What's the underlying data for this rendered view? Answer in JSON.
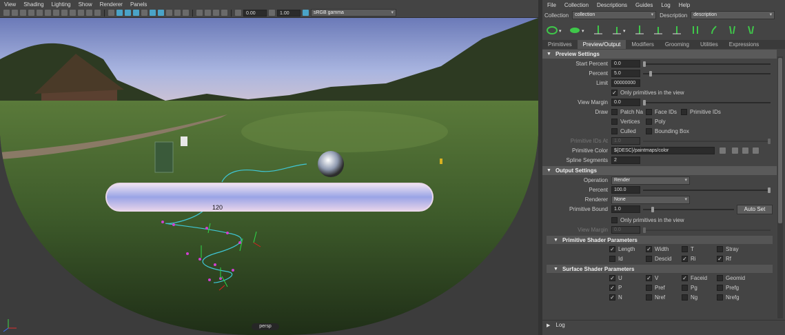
{
  "viewport": {
    "menu": [
      "View",
      "Shading",
      "Lighting",
      "Show",
      "Renderer",
      "Panels"
    ],
    "exposure": "0.00",
    "gamma_value": "1.00",
    "color_space": "sRGB gamma",
    "camera_label": "persp",
    "hud_number": "120"
  },
  "editor": {
    "menu": [
      "File",
      "Collection",
      "Descriptions",
      "Guides",
      "Log",
      "Help"
    ],
    "collection_label": "Collection",
    "collection_value": "collection",
    "description_label": "Description",
    "description_value": "description",
    "tabs": [
      "Primitives",
      "Preview/Output",
      "Modifiers",
      "Grooming",
      "Utilities",
      "Expressions"
    ],
    "active_tab": "Preview/Output",
    "preview": {
      "title": "Preview Settings",
      "start_percent_label": "Start Percent",
      "start_percent": "0.0",
      "percent_label": "Percent",
      "percent": "5.0",
      "limit_label": "Limit",
      "limit": "00000000",
      "only_prims_label": "Only primitives in the view",
      "view_margin_label": "View Margin",
      "view_margin": "0.0",
      "draw_label": "Draw",
      "draw_options": [
        "Patch Na",
        "Face IDs",
        "Primitive IDs",
        "Vertices",
        "Poly",
        "Culled",
        "Bounding Box"
      ],
      "prim_ids_at_label": "Primitive IDs At",
      "prim_ids_at": "1.0",
      "prim_color_label": "Primitive Color",
      "prim_color": "${DESC}/paintmaps/color",
      "spline_segments_label": "Spline Segments",
      "spline_segments": "2"
    },
    "output": {
      "title": "Output Settings",
      "operation_label": "Operation",
      "operation": "Render",
      "percent_label": "Percent",
      "percent": "100.0",
      "renderer_label": "Renderer",
      "renderer": "None",
      "prim_bound_label": "Primitive Bound",
      "prim_bound": "1.0",
      "auto_set": "Auto Set",
      "only_prims_label": "Only primitives in the view",
      "view_margin_label": "View Margin",
      "view_margin": "0.0"
    },
    "prim_shader": {
      "title": "Primitive Shader Parameters",
      "params": [
        {
          "label": "Length",
          "checked": true
        },
        {
          "label": "Width",
          "checked": true
        },
        {
          "label": "T",
          "checked": false
        },
        {
          "label": "Stray",
          "checked": false
        },
        {
          "label": "Id",
          "checked": false
        },
        {
          "label": "Descid",
          "checked": false
        },
        {
          "label": "Ri",
          "checked": true
        },
        {
          "label": "Rf",
          "checked": true
        }
      ]
    },
    "surf_shader": {
      "title": "Surface Shader Parameters",
      "params": [
        {
          "label": "U",
          "checked": true
        },
        {
          "label": "V",
          "checked": true
        },
        {
          "label": "Faceid",
          "checked": true
        },
        {
          "label": "Geomid",
          "checked": false
        },
        {
          "label": "P",
          "checked": true
        },
        {
          "label": "Pref",
          "checked": false
        },
        {
          "label": "Pg",
          "checked": false
        },
        {
          "label": "Prefg",
          "checked": false
        },
        {
          "label": "N",
          "checked": true
        },
        {
          "label": "Nref",
          "checked": false
        },
        {
          "label": "Ng",
          "checked": false
        },
        {
          "label": "Nrefg",
          "checked": false
        }
      ]
    },
    "log_label": "Log"
  }
}
